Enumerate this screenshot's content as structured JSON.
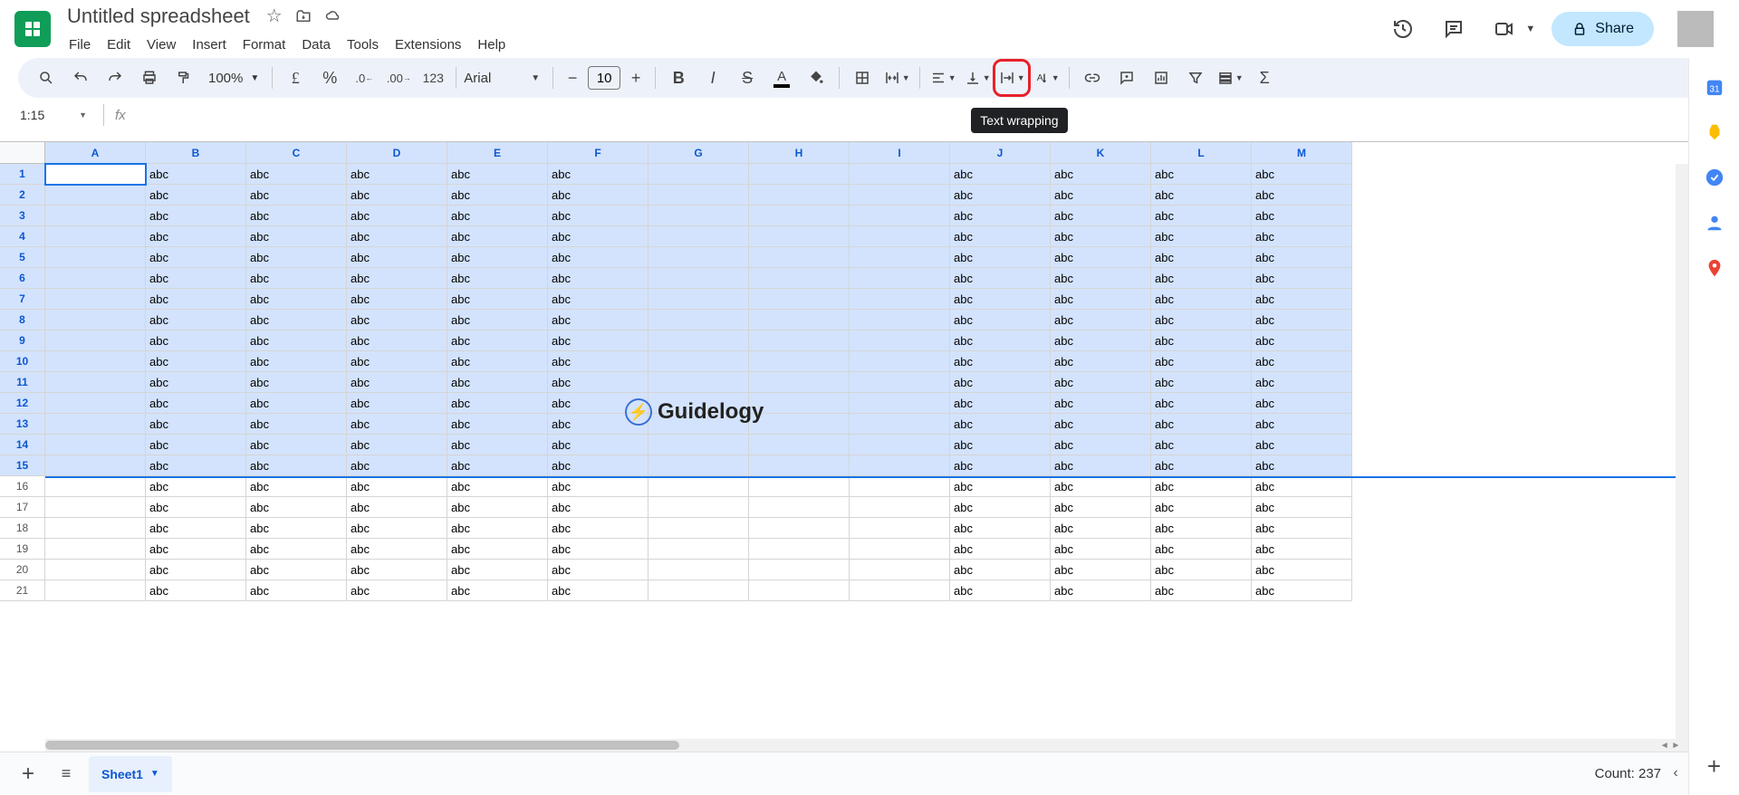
{
  "doc": {
    "title": "Untitled spreadsheet"
  },
  "menus": [
    "File",
    "Edit",
    "View",
    "Insert",
    "Format",
    "Data",
    "Tools",
    "Extensions",
    "Help"
  ],
  "share_label": "Share",
  "toolbar": {
    "zoom": "100%",
    "font": "Arial",
    "fontsize": "10",
    "tooltip": "Text wrapping"
  },
  "namebox": "1:15",
  "columns": [
    "A",
    "B",
    "C",
    "D",
    "E",
    "F",
    "G",
    "H",
    "I",
    "J",
    "K",
    "L",
    "M"
  ],
  "rows": 21,
  "selected_rows": 15,
  "empty_cols": [
    "A",
    "G",
    "H",
    "I"
  ],
  "cell_value": "abc",
  "sheet_tab": "Sheet1",
  "status": "Count: 237",
  "watermark": "Guidelogy"
}
